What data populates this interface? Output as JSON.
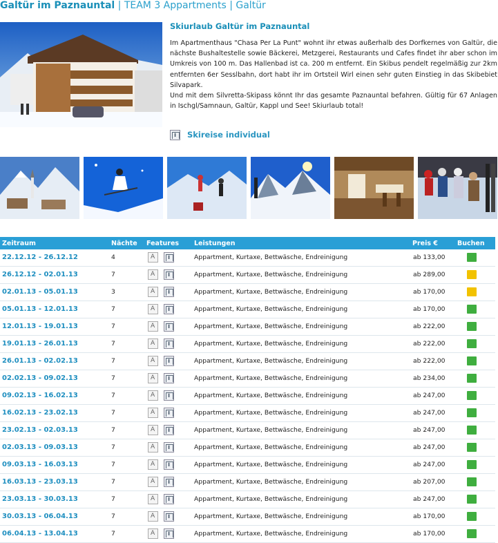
{
  "header": {
    "title_strong": "Galtür im Paznauntal",
    "title_rest": " | TEAM 3 Appartments | Galtür"
  },
  "intro": {
    "title": "Skiurlaub Galtür im Paznauntal",
    "paragraph1": "Im Apartmenthaus \"Chasa Per La Punt\" wohnt ihr etwas außerhalb des Dorfkernes von Galtür, die nächste Bushaltestelle sowie Bäckerei, Metzgerei, Restaurants und Cafes findet ihr aber schon im Umkreis von 100 m. Das Hallenbad ist ca. 200 m entfernt. Ein Skibus pendelt regelmäßig zur 2km entfernten 6er Sesslbahn, dort habt ihr im Ortsteil Wirl einen sehr guten Einstieg in das Skibebiet Silvapark.",
    "paragraph2": "Und mit dem Silvretta-Skipass könnt Ihr das gesamte Paznauntal befahren. Gültig für 67 Anlagen in Ischgl/Samnaun, Galtür, Kappl und See! Skiurlaub total!"
  },
  "skireise_link": "Skireise individual",
  "table": {
    "headers": {
      "zeitraum": "Zeitraum",
      "naechte": "Nächte",
      "features": "Features",
      "leistungen": "Leistungen",
      "preis": "Preis €",
      "buchen": "Buchen"
    },
    "rows": [
      {
        "zeitraum": "22.12.12 - 26.12.12",
        "naechte": "4",
        "leistungen": "Appartment, Kurtaxe, Bettwäsche, Endreinigung",
        "preis": "ab 133,00",
        "status": "green"
      },
      {
        "zeitraum": "26.12.12 - 02.01.13",
        "naechte": "7",
        "leistungen": "Appartment, Kurtaxe, Bettwäsche, Endreinigung",
        "preis": "ab 289,00",
        "status": "yellow"
      },
      {
        "zeitraum": "02.01.13 - 05.01.13",
        "naechte": "3",
        "leistungen": "Appartment, Kurtaxe, Bettwäsche, Endreinigung",
        "preis": "ab 170,00",
        "status": "yellow"
      },
      {
        "zeitraum": "05.01.13 - 12.01.13",
        "naechte": "7",
        "leistungen": "Appartment, Kurtaxe, Bettwäsche, Endreinigung",
        "preis": "ab 170,00",
        "status": "green"
      },
      {
        "zeitraum": "12.01.13 - 19.01.13",
        "naechte": "7",
        "leistungen": "Appartment, Kurtaxe, Bettwäsche, Endreinigung",
        "preis": "ab 222,00",
        "status": "green"
      },
      {
        "zeitraum": "19.01.13 - 26.01.13",
        "naechte": "7",
        "leistungen": "Appartment, Kurtaxe, Bettwäsche, Endreinigung",
        "preis": "ab 222,00",
        "status": "green"
      },
      {
        "zeitraum": "26.01.13 - 02.02.13",
        "naechte": "7",
        "leistungen": "Appartment, Kurtaxe, Bettwäsche, Endreinigung",
        "preis": "ab 222,00",
        "status": "green"
      },
      {
        "zeitraum": "02.02.13 - 09.02.13",
        "naechte": "7",
        "leistungen": "Appartment, Kurtaxe, Bettwäsche, Endreinigung",
        "preis": "ab 234,00",
        "status": "green"
      },
      {
        "zeitraum": "09.02.13 - 16.02.13",
        "naechte": "7",
        "leistungen": "Appartment, Kurtaxe, Bettwäsche, Endreinigung",
        "preis": "ab 247,00",
        "status": "green"
      },
      {
        "zeitraum": "16.02.13 - 23.02.13",
        "naechte": "7",
        "leistungen": "Appartment, Kurtaxe, Bettwäsche, Endreinigung",
        "preis": "ab 247,00",
        "status": "green"
      },
      {
        "zeitraum": "23.02.13 - 02.03.13",
        "naechte": "7",
        "leistungen": "Appartment, Kurtaxe, Bettwäsche, Endreinigung",
        "preis": "ab 247,00",
        "status": "green"
      },
      {
        "zeitraum": "02.03.13 - 09.03.13",
        "naechte": "7",
        "leistungen": "Appartment, Kurtaxe, Bettwäsche, Endreinigung",
        "preis": "ab 247,00",
        "status": "green"
      },
      {
        "zeitraum": "09.03.13 - 16.03.13",
        "naechte": "7",
        "leistungen": "Appartment, Kurtaxe, Bettwäsche, Endreinigung",
        "preis": "ab 247,00",
        "status": "green"
      },
      {
        "zeitraum": "16.03.13 - 23.03.13",
        "naechte": "7",
        "leistungen": "Appartment, Kurtaxe, Bettwäsche, Endreinigung",
        "preis": "ab 207,00",
        "status": "green"
      },
      {
        "zeitraum": "23.03.13 - 30.03.13",
        "naechte": "7",
        "leistungen": "Appartment, Kurtaxe, Bettwäsche, Endreinigung",
        "preis": "ab 247,00",
        "status": "green"
      },
      {
        "zeitraum": "30.03.13 - 06.04.13",
        "naechte": "7",
        "leistungen": "Appartment, Kurtaxe, Bettwäsche, Endreinigung",
        "preis": "ab 170,00",
        "status": "green"
      },
      {
        "zeitraum": "06.04.13 - 13.04.13",
        "naechte": "7",
        "leistungen": "Appartment, Kurtaxe, Bettwäsche, Endreinigung",
        "preis": "ab 170,00",
        "status": "green"
      }
    ]
  },
  "colors": {
    "accent": "#1a8fb8",
    "table_header": "#2a9fd6",
    "status_green": "#3fae3f",
    "status_yellow": "#f2c200"
  }
}
